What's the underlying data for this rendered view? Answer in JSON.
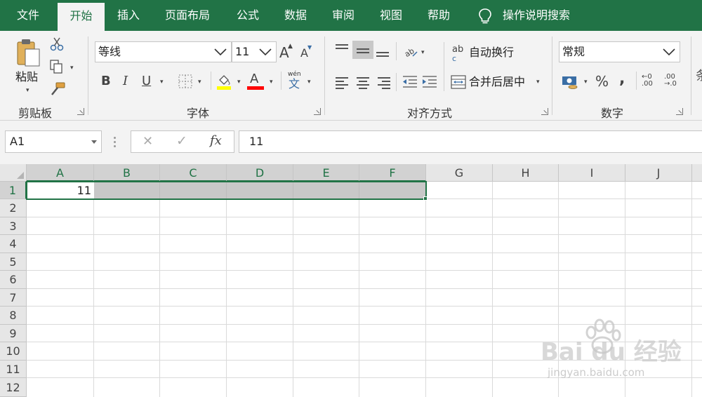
{
  "menu": {
    "tabs": [
      {
        "label": "文件",
        "active": false
      },
      {
        "label": "开始",
        "active": true
      },
      {
        "label": "插入",
        "active": false
      },
      {
        "label": "页面布局",
        "active": false
      },
      {
        "label": "公式",
        "active": false
      },
      {
        "label": "数据",
        "active": false
      },
      {
        "label": "审阅",
        "active": false
      },
      {
        "label": "视图",
        "active": false
      },
      {
        "label": "帮助",
        "active": false
      }
    ],
    "search_icon": "lightbulb-icon",
    "search_label": "操作说明搜索"
  },
  "ribbon": {
    "clipboard": {
      "label": "剪贴板",
      "paste_label": "粘贴",
      "icons": [
        "paste-icon",
        "cut-icon",
        "copy-icon",
        "format-painter-icon"
      ]
    },
    "font": {
      "label": "字体",
      "font_name": "等线",
      "font_size": "11",
      "bold": "B",
      "italic": "I",
      "underline": "U",
      "grow": "A",
      "shrink": "A",
      "font_color_glyph": "A",
      "phonetic_top": "wén",
      "phonetic_char": "文",
      "fill_color": "#ffff00",
      "font_color": "#ff0000"
    },
    "alignment": {
      "label": "对齐方式",
      "wrap_text": "自动换行",
      "merge_center": "合并后居中",
      "wrap_glyph": "ab",
      "wrap_glyph2": "c"
    },
    "number": {
      "label": "数字",
      "format": "常规",
      "percent": "%",
      "comma": ",",
      "inc_decimal_top": "←0",
      "inc_decimal_bottom": ".00",
      "dec_decimal_top": ".00",
      "dec_decimal_bottom": "→.0"
    },
    "partial_next_group": "条"
  },
  "formula_bar": {
    "name_box": "A1",
    "cancel": "✕",
    "enter": "✓",
    "fx": "fx",
    "content": "11"
  },
  "sheet": {
    "columns": [
      "A",
      "B",
      "C",
      "D",
      "E",
      "F",
      "G",
      "H",
      "I",
      "J"
    ],
    "rows": [
      "1",
      "2",
      "3",
      "4",
      "5",
      "6",
      "7",
      "8",
      "9",
      "10",
      "11",
      "12"
    ],
    "cell_a1": "11",
    "selected_range": "A1:F1"
  },
  "watermark": {
    "text": "Bai du 经验",
    "url": "jingyan.baidu.com"
  },
  "colors": {
    "accent": "#217346",
    "ribbon_bg": "#f3f3f3",
    "selection_fill": "#c8c8c8"
  }
}
